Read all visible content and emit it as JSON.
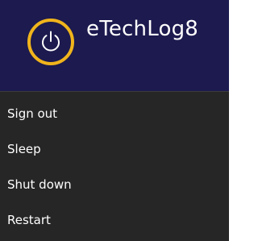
{
  "header": {
    "title": "eTechLog8",
    "power_icon": "power-icon",
    "highlight_color": "#f0b41c",
    "background_color": "#1c1a4e"
  },
  "menu": {
    "background_color": "#262626",
    "items": [
      {
        "label": "Sign out"
      },
      {
        "label": "Sleep"
      },
      {
        "label": "Shut down"
      },
      {
        "label": "Restart"
      }
    ]
  }
}
